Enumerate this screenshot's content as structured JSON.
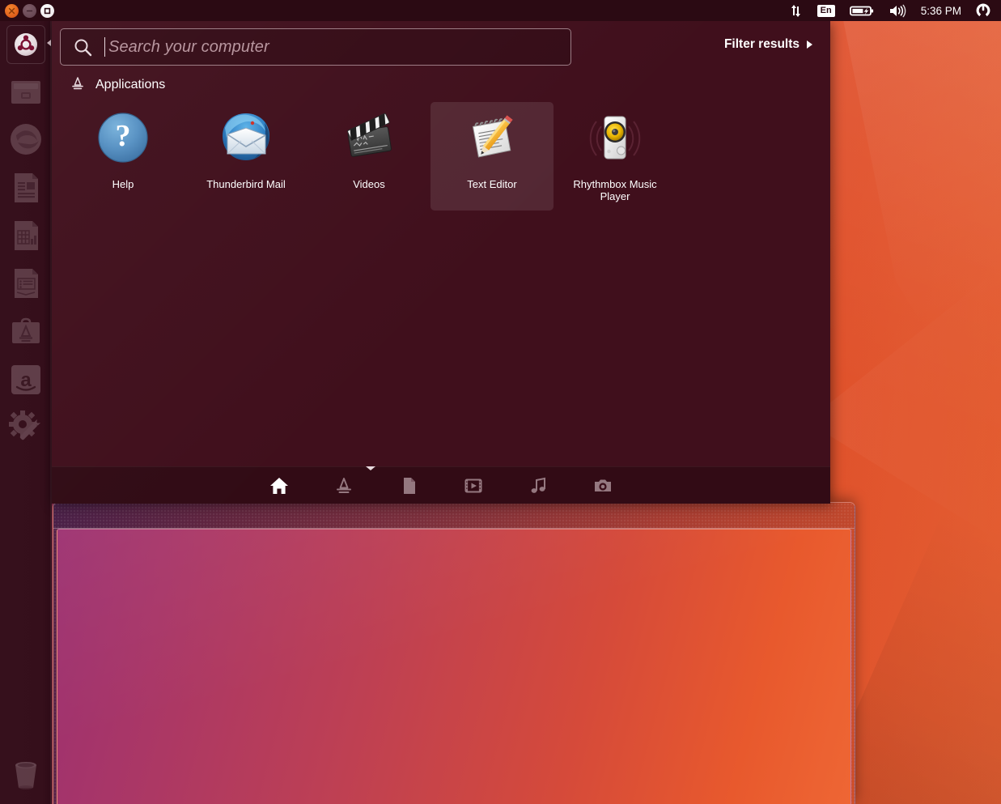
{
  "panel": {
    "window_controls": [
      {
        "name": "close",
        "label": "Close",
        "icon": "close-icon",
        "color": "#e2621d"
      },
      {
        "name": "minimize",
        "label": "Minimize",
        "icon": "minimize-icon",
        "color": "#6a4a56"
      },
      {
        "name": "maximize",
        "label": "Maximize",
        "icon": "maximize-icon",
        "color": "#ffffff"
      }
    ],
    "indicators": [
      {
        "name": "network",
        "icon": "network-transfer-icon",
        "label": ""
      },
      {
        "name": "keyboard",
        "icon": "keyboard-layout-icon",
        "label": "En"
      },
      {
        "name": "battery",
        "icon": "battery-charging-icon",
        "label": ""
      },
      {
        "name": "sound",
        "icon": "volume-icon",
        "label": ""
      },
      {
        "name": "clock",
        "icon": "clock-icon",
        "label": "5:36 PM"
      },
      {
        "name": "session",
        "icon": "session-gear-icon",
        "label": ""
      }
    ],
    "clock": "5:36 PM",
    "keyboard_layout": "En"
  },
  "launcher": {
    "bfb": {
      "label": "Ubuntu",
      "icon": "ubuntu-logo-icon"
    },
    "items": [
      {
        "label": "Files",
        "icon": "files-icon"
      },
      {
        "label": "Firefox Web Browser",
        "icon": "firefox-icon"
      },
      {
        "label": "LibreOffice Writer",
        "icon": "libreoffice-writer-icon"
      },
      {
        "label": "LibreOffice Calc",
        "icon": "libreoffice-calc-icon"
      },
      {
        "label": "LibreOffice Impress",
        "icon": "libreoffice-impress-icon"
      },
      {
        "label": "Ubuntu Software Center",
        "icon": "software-center-icon"
      },
      {
        "label": "Amazon",
        "icon": "amazon-icon"
      },
      {
        "label": "System Settings",
        "icon": "system-settings-icon"
      }
    ],
    "trash": {
      "label": "Trash",
      "icon": "trash-icon"
    }
  },
  "dash": {
    "search": {
      "placeholder": "Search your computer",
      "value": "",
      "icon": "search-icon"
    },
    "filter_results": {
      "label": "Filter results",
      "icon": "chevron-right-icon"
    },
    "category": {
      "label": "Applications",
      "icon": "applications-icon"
    },
    "results": [
      {
        "label": "Help",
        "icon": "help-icon",
        "selected": false
      },
      {
        "label": "Thunderbird Mail",
        "icon": "thunderbird-icon",
        "selected": false
      },
      {
        "label": "Videos",
        "icon": "videos-icon",
        "selected": false
      },
      {
        "label": "Text Editor",
        "icon": "text-editor-icon",
        "selected": true
      },
      {
        "label": "Rhythmbox Music Player",
        "icon": "rhythmbox-icon",
        "selected": false
      }
    ],
    "lenses": [
      {
        "label": "Home",
        "icon": "home-lens-icon",
        "active": true
      },
      {
        "label": "Applications",
        "icon": "applications-lens-icon",
        "active": false
      },
      {
        "label": "Files & Folders",
        "icon": "files-lens-icon",
        "active": false
      },
      {
        "label": "Videos",
        "icon": "video-lens-icon",
        "active": false
      },
      {
        "label": "Music",
        "icon": "music-lens-icon",
        "active": false
      },
      {
        "label": "Photos",
        "icon": "photos-lens-icon",
        "active": false
      }
    ]
  },
  "colors": {
    "dash_background": "#400f1c",
    "panel_background": "#2b0a13",
    "launcher_background": "#36101c",
    "accent_orange": "#e2621d",
    "selection_highlight": "#5a2e3e",
    "text_primary": "#ffffff",
    "placeholder_text": "#b8969f"
  }
}
